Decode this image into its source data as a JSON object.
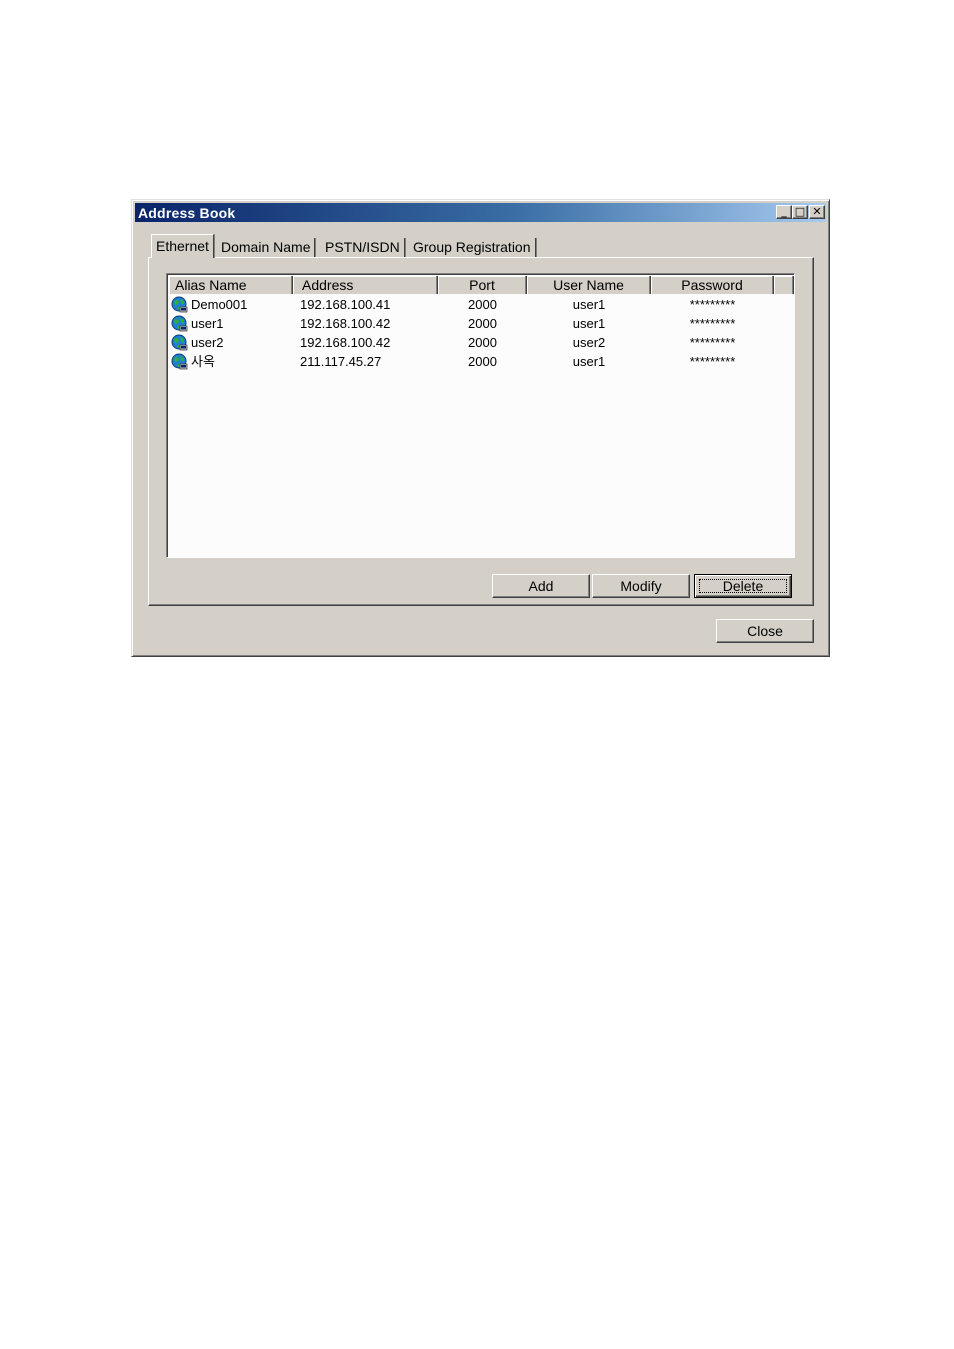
{
  "window": {
    "title": "Address Book",
    "minimize_glyph": "_",
    "maximize_glyph": "□",
    "close_glyph": "✕"
  },
  "tabs": [
    {
      "label": "Ethernet",
      "active": true
    },
    {
      "label": "Domain Name",
      "active": false
    },
    {
      "label": "PSTN/ISDN",
      "active": false
    },
    {
      "label": "Group Registration",
      "active": false
    }
  ],
  "table": {
    "columns": [
      "Alias Name",
      "Address",
      "Port",
      "User Name",
      "Password"
    ],
    "rows": [
      {
        "icon": "globe-computer-icon",
        "alias": "Demo001",
        "address": "192.168.100.41",
        "port": "2000",
        "user": "user1",
        "password": "*********"
      },
      {
        "icon": "globe-computer-icon",
        "alias": "user1",
        "address": "192.168.100.42",
        "port": "2000",
        "user": "user1",
        "password": "*********"
      },
      {
        "icon": "globe-computer-icon",
        "alias": "user2",
        "address": "192.168.100.42",
        "port": "2000",
        "user": "user2",
        "password": "*********"
      },
      {
        "icon": "globe-computer-icon",
        "alias": "사옥",
        "address": "211.117.45.27",
        "port": "2000",
        "user": "user1",
        "password": "*********"
      }
    ]
  },
  "buttons": {
    "add": "Add",
    "modify": "Modify",
    "delete": "Delete",
    "close": "Close"
  },
  "colors": {
    "titlebar_start": "#0a246a",
    "titlebar_end": "#a6caf0",
    "dialog_face": "#d4d0c8"
  }
}
